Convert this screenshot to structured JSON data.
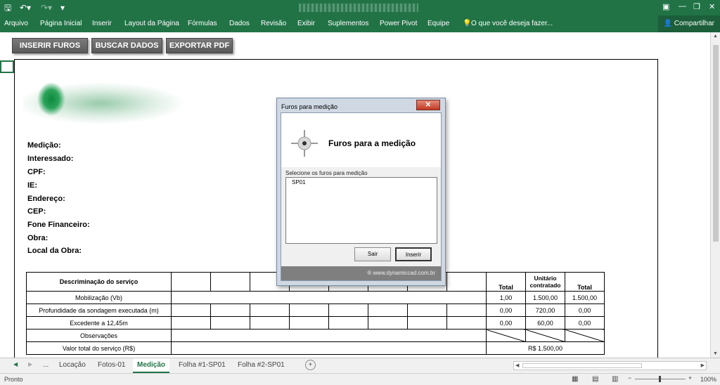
{
  "titlebar": {
    "save_icon": "save-icon",
    "undo_icon": "undo-icon",
    "redo_icon": "redo-icon",
    "customize_icon": "customize-qat-icon",
    "window_controls": [
      "ribbon-display-icon",
      "minimize-icon",
      "restore-icon",
      "close-icon"
    ]
  },
  "ribbon": {
    "tabs": [
      "Arquivo",
      "Página Inicial",
      "Inserir",
      "Layout da Página",
      "Fórmulas",
      "Dados",
      "Revisão",
      "Exibir",
      "Suplementos",
      "Power Pivot",
      "Equipe"
    ],
    "tell_me": "O que você deseja fazer...",
    "share": "Compartilhar"
  },
  "macro_buttons": {
    "insert": "INSERIR FUROS",
    "fetch": "BUSCAR DADOS",
    "export": "EXPORTAR PDF"
  },
  "form_fields": [
    "Medição:",
    "Interessado:",
    "CPF:",
    "IE:",
    "Endereço:",
    "CEP:",
    "Fone Financeiro:",
    "Obra:",
    "Local da Obra:"
  ],
  "table": {
    "header_desc": "Descriminação do serviço",
    "header_total": "Total",
    "header_unit": "Unitário contratado",
    "header_total2": "Total",
    "rows": [
      {
        "desc": "Mobilização (Vb)",
        "qty": "1,00",
        "unit": "1.500,00",
        "total": "1.500,00"
      },
      {
        "desc": "Profundidade da sondagem executada (m)",
        "qty": "0,00",
        "unit": "720,00",
        "total": "0,00"
      },
      {
        "desc": "Excedente a 12,45m",
        "qty": "0,00",
        "unit": "60,00",
        "total": "0,00"
      },
      {
        "desc": "Observações",
        "qty": "",
        "unit": "",
        "total": ""
      }
    ],
    "total_label": "Valor total do serviço (R$)",
    "total_value": "R$ 1.500,00"
  },
  "dialog": {
    "title": "Furos para medição",
    "close": "✕",
    "heading": "Furos para a medição",
    "label": "Selecione os furos para medição",
    "items": [
      "SP01"
    ],
    "exit": "Sair",
    "insert": "Inserir",
    "footer": "® www.dynamiccad.com.br"
  },
  "sheet_tabs": [
    "Locação",
    "Fotos-01",
    "Medição",
    "Folha #1-SP01",
    "Folha #2-SP01"
  ],
  "sheet_nav": {
    "ellipsis": "..."
  },
  "statusbar": {
    "status": "Pronto",
    "zoom": "100%"
  }
}
